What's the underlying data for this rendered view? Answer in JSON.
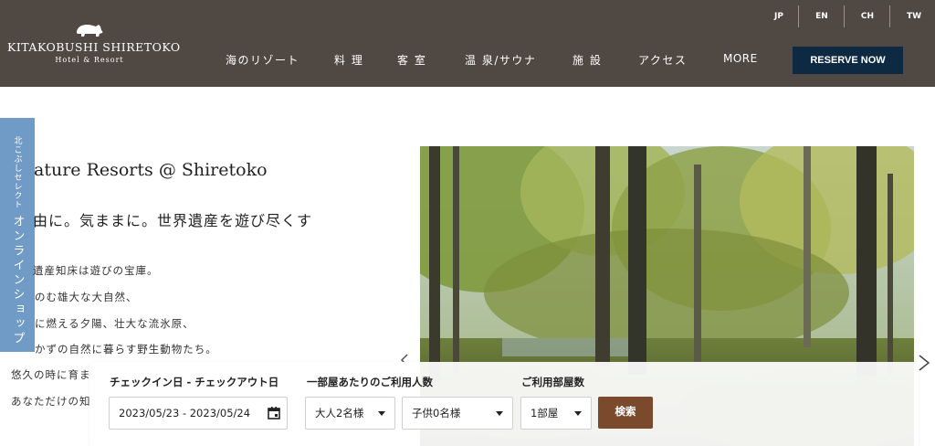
{
  "header": {
    "logo": {
      "title": "KITAKOBUSHI SHIRETOKO",
      "subtitle": "Hotel & Resort"
    },
    "languages": [
      "JP",
      "EN",
      "CH",
      "TW"
    ],
    "nav": [
      "海のリゾート",
      "料 理",
      "客 室",
      "温 泉/サウナ",
      "施 設",
      "アクセス",
      "MORE"
    ],
    "reserve_label": "RESERVE NOW"
  },
  "side_tab": {
    "small": "北こぶしセレクト",
    "big": "オンラインショップ"
  },
  "hero": {
    "title": "ature Resorts @ Shiretoko",
    "subtitle": "由に。気ままに。世界遺産を遊び尽くす",
    "paragraph": [
      "遺産知床は遊びの宝庫。",
      "のむ雄大な大自然、",
      "に燃える夕陽、壮大な流氷原、",
      "かずの自然に暮らす野生動物たち。",
      "悠久の時に育ま",
      "あなただけの知"
    ]
  },
  "booking": {
    "labels": {
      "dates": "チェックイン日 - チェックアウト日",
      "guests": "一部屋あたりのご利用人数",
      "rooms": "ご利用部屋数"
    },
    "date_value": "2023/05/23 - 2023/05/24",
    "adults": "大人2名様",
    "children": "子供0名様",
    "rooms": "1部屋",
    "search_label": "検索"
  },
  "colors": {
    "header_bg": "#504843",
    "reserve_bg": "#0e2a43",
    "side_tab": "#6f9bc6",
    "search_btn": "#7b4a2d"
  }
}
